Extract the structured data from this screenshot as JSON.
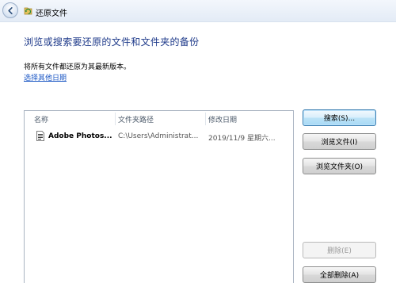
{
  "window": {
    "title": "还原文件"
  },
  "page": {
    "heading": "浏览或搜索要还原的文件和文件夹的备份",
    "subtitle": "将所有文件都还原为其最新版本。",
    "choose_date_link": "选择其他日期"
  },
  "list": {
    "columns": [
      "名称",
      "文件夹路径",
      "修改日期"
    ],
    "rows": [
      {
        "name": "Adobe Photos...",
        "path": "C:\\Users\\Administrat...",
        "modified": "2019/11/9 星期六..."
      }
    ]
  },
  "buttons": {
    "search": "搜索(S)...",
    "browse_files": "浏览文件(I)",
    "browse_folders": "浏览文件夹(O)",
    "delete": "删除(E)",
    "delete_all": "全部删除(A)"
  },
  "colors": {
    "heading": "#1e3a8a",
    "link": "#1a56c4"
  }
}
